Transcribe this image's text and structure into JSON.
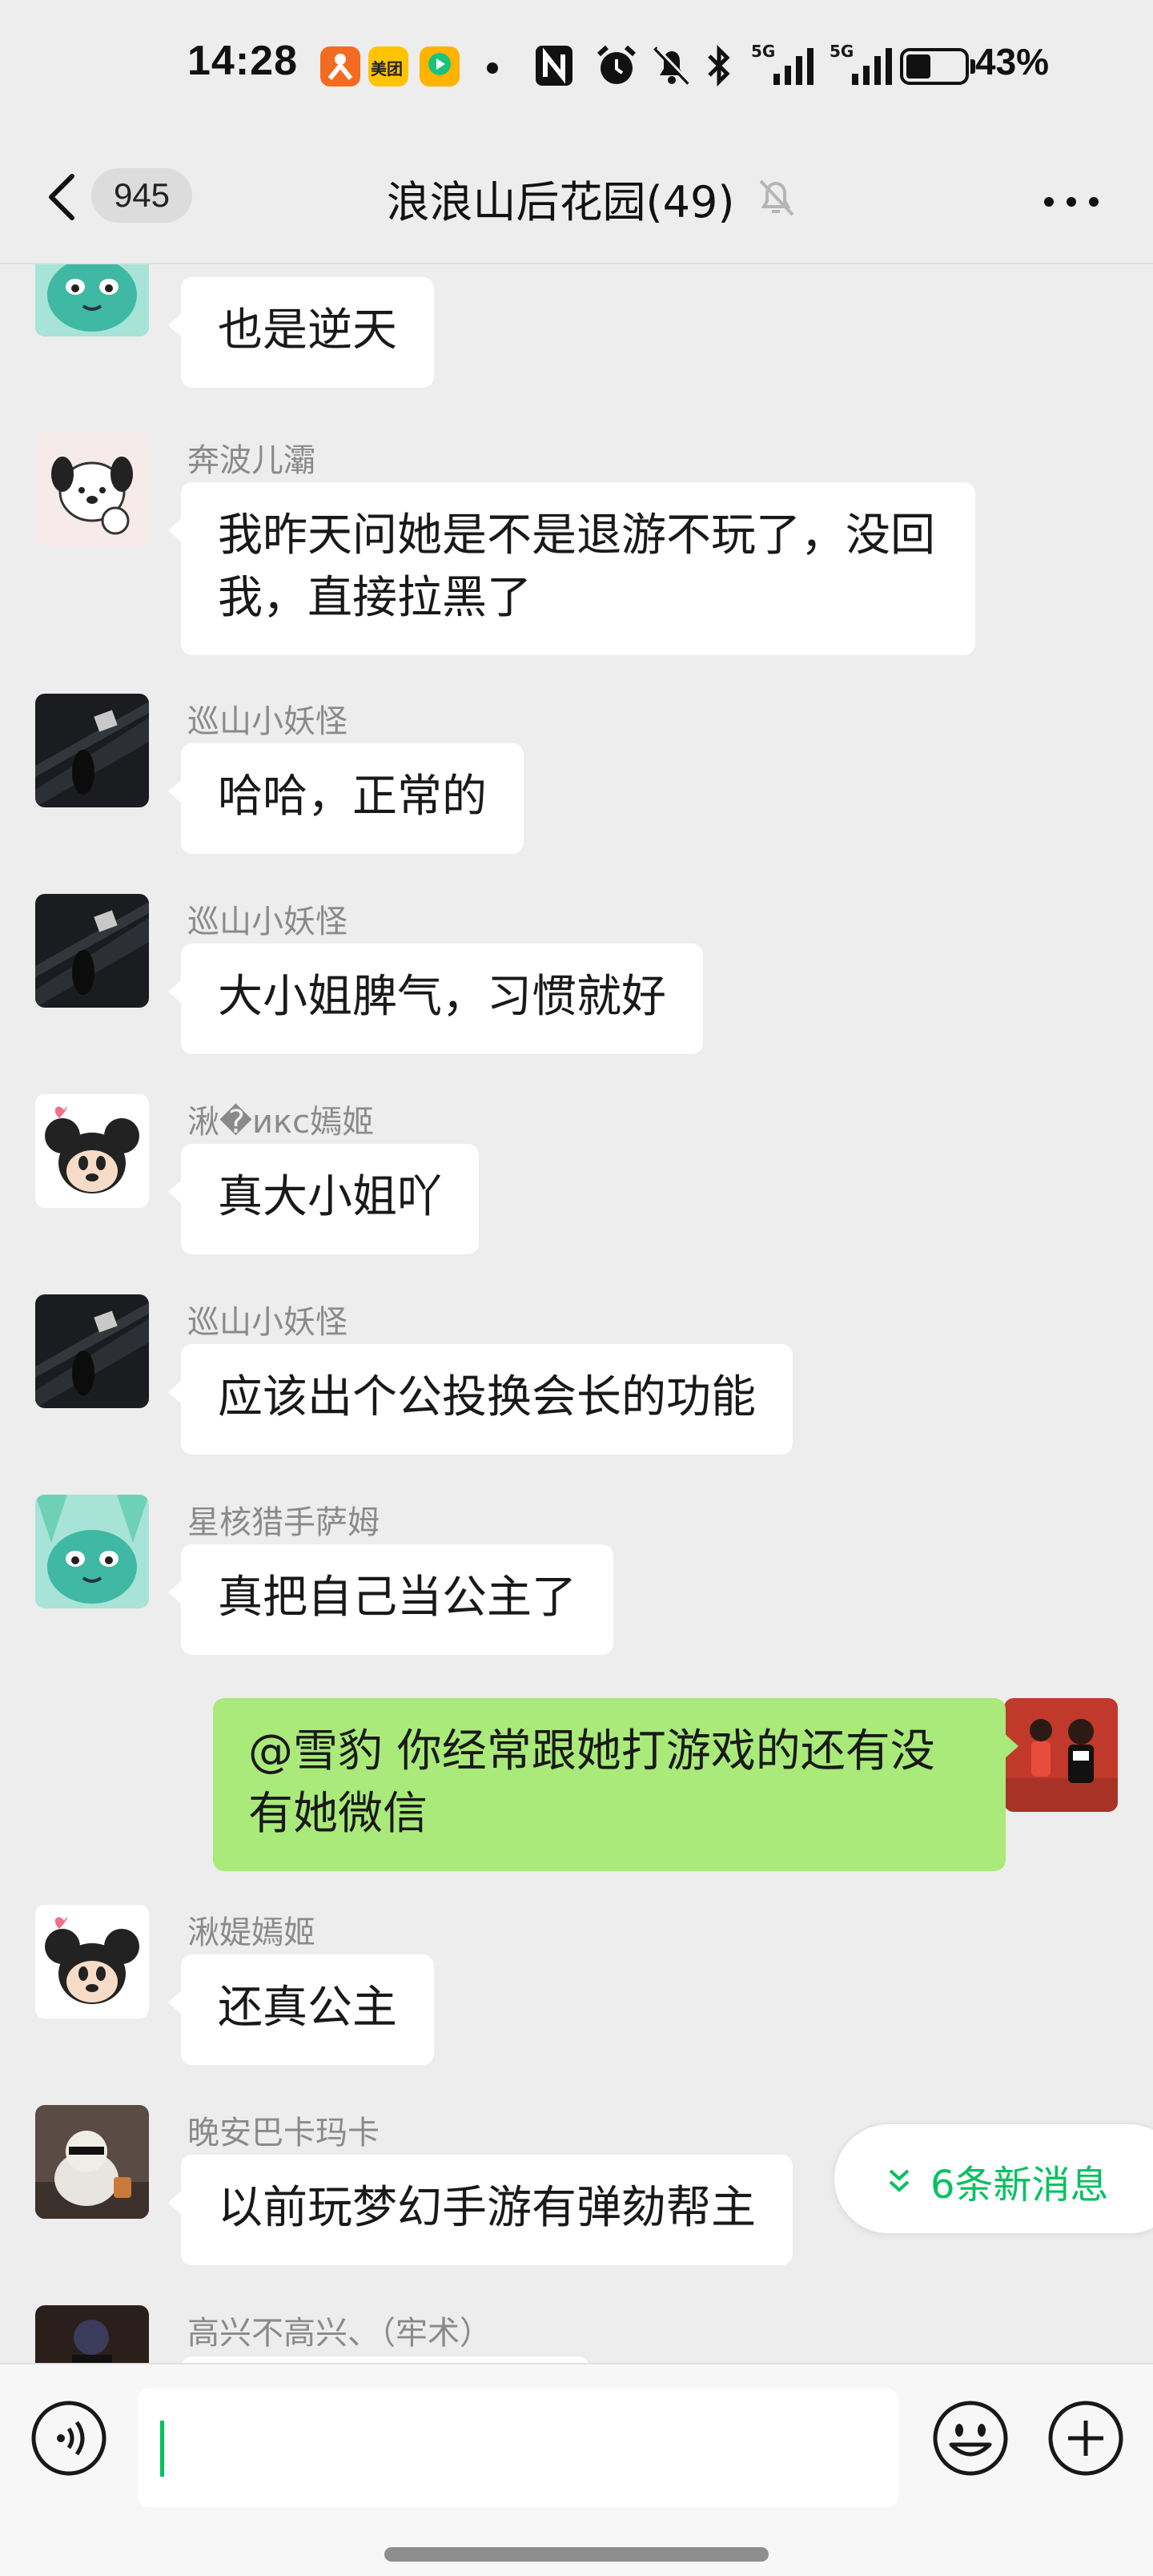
{
  "status_bar": {
    "time": "14:28",
    "app_icons": [
      "didi-app-icon",
      "meituan-app-icon",
      "video-app-icon"
    ],
    "meituan_label": "美团",
    "network_1": "5G",
    "network_2": "5G",
    "battery_level": 0.43,
    "battery_text": "43%"
  },
  "header": {
    "unread_count": "945",
    "title": "浪浪山后花园(49)"
  },
  "messages": [
    {
      "sender": "",
      "text": "也是逆天",
      "avatar": "green-cat"
    },
    {
      "sender": "奔波儿灞",
      "text": "我昨天问她是不是退游不玩了，没回我，直接拉黑了",
      "avatar": "pochacco"
    },
    {
      "sender": "巡山小妖怪",
      "text": "哈哈，正常的",
      "avatar": "dark-stairs"
    },
    {
      "sender": "巡山小妖怪",
      "text": "大小姐脾气，习惯就好",
      "avatar": "dark-stairs"
    },
    {
      "sender": "湫�икс嫣姬",
      "text": "真大小姐吖",
      "avatar": "mickey"
    },
    {
      "sender": "巡山小妖怪",
      "text": "应该出个公投换会长的功能",
      "avatar": "dark-stairs"
    },
    {
      "sender": "星核猎手萨姆",
      "text": "真把自己当公主了",
      "avatar": "green-cat"
    },
    {
      "sender": "",
      "text": "@雪豹  你经常跟她打游戏的还有没有她微信",
      "avatar": "red-couple",
      "mine": true
    },
    {
      "sender": "湫媞嫣姬",
      "text": "还真公主",
      "avatar": "mickey"
    },
    {
      "sender": "晚安巴卡玛卡",
      "text": "以前玩梦幻手游有弹劾帮主",
      "avatar": "cat-sunglasses"
    },
    {
      "sender": "高兴不高兴、（牢术）",
      "text": "",
      "avatar": "dark-person"
    }
  ],
  "new_messages": "6条新消息",
  "colors": {
    "background": "#ededed",
    "bubble_other": "#ffffff",
    "bubble_mine": "#a9ea7a",
    "accent": "#07c160"
  }
}
